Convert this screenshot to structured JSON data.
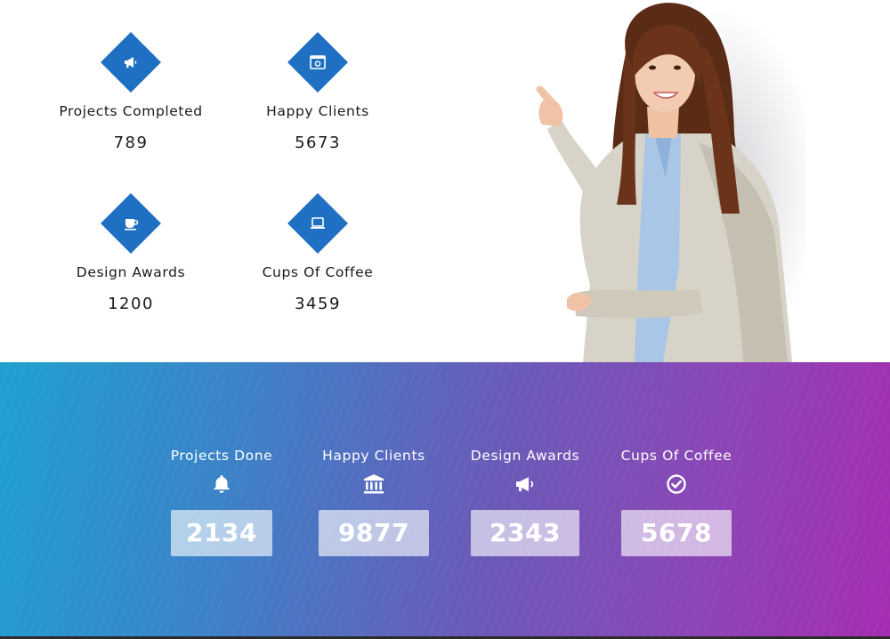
{
  "top_stats": [
    {
      "label": "Projects Completed",
      "value": "789",
      "icon": "megaphone-icon"
    },
    {
      "label": "Happy Clients",
      "value": "5673",
      "icon": "browser-window-icon"
    },
    {
      "label": "Design Awards",
      "value": "1200",
      "icon": "coffee-cup-icon"
    },
    {
      "label": "Cups Of Coffee",
      "value": "3459",
      "icon": "laptop-icon"
    }
  ],
  "counters": [
    {
      "label": "Projects Done",
      "value": "2134",
      "icon": "bell-icon"
    },
    {
      "label": "Happy Clients",
      "value": "9877",
      "icon": "bank-building-icon"
    },
    {
      "label": "Design Awards",
      "value": "2343",
      "icon": "megaphone-icon"
    },
    {
      "label": "Cups Of Coffee",
      "value": "5678",
      "icon": "check-circle-icon"
    }
  ],
  "colors": {
    "accent_blue": "#1f6fc2",
    "gradient_start": "#1fa0d0",
    "gradient_end": "#a52db1"
  }
}
